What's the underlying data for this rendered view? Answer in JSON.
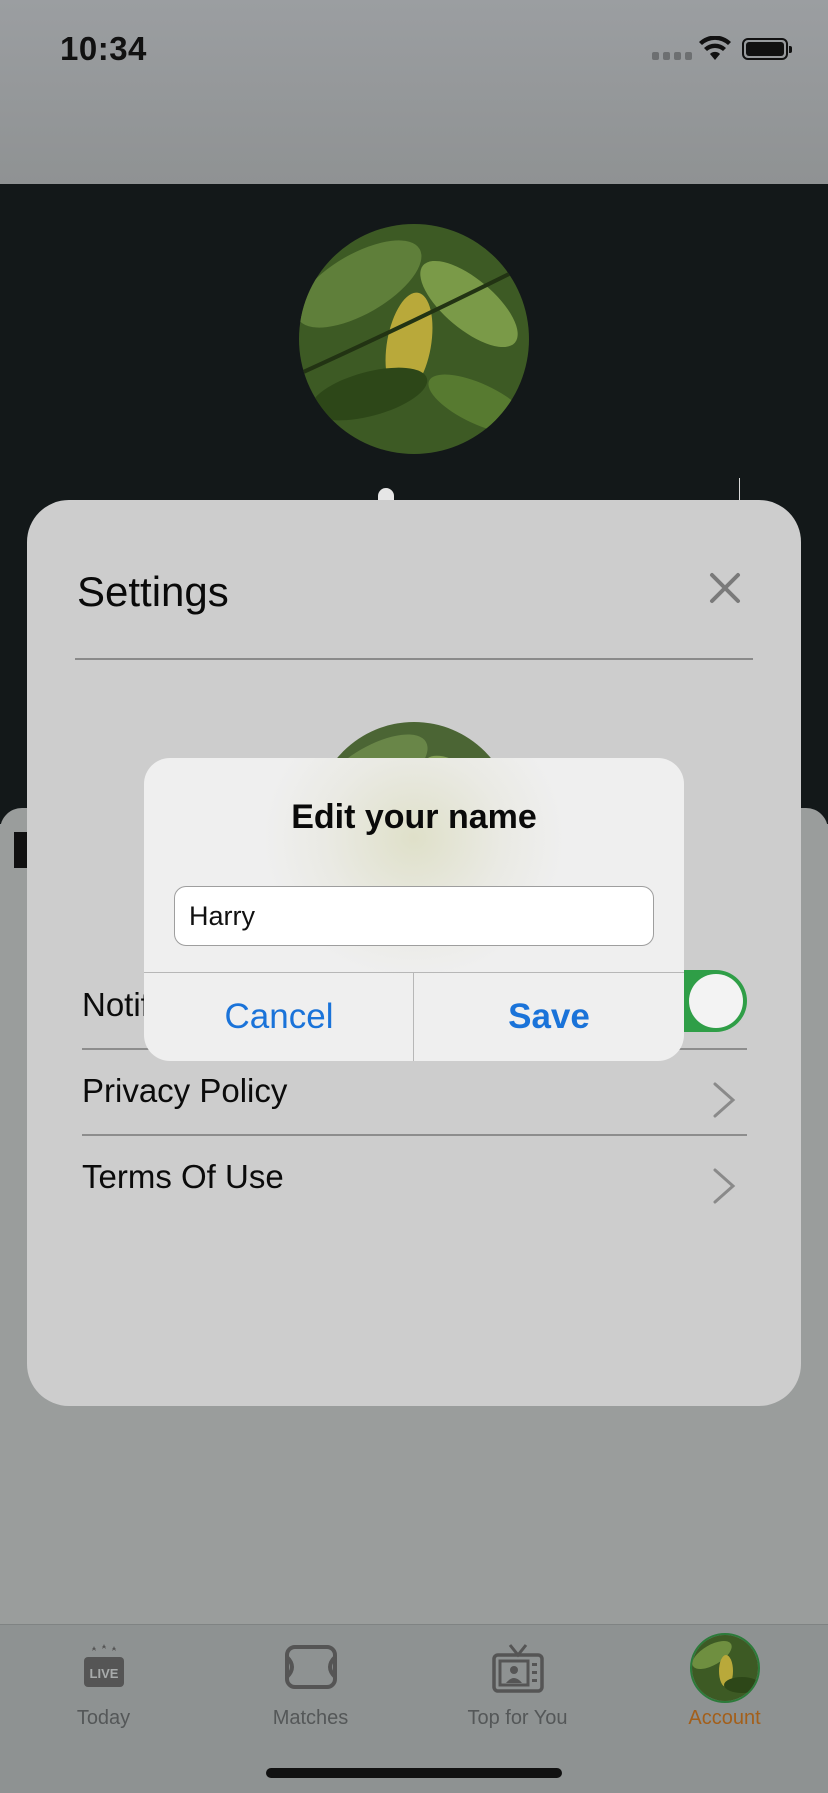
{
  "status_bar": {
    "time": "10:34"
  },
  "profile": {
    "avatar_icon": "leaf-photo"
  },
  "settings": {
    "title": "Settings",
    "close_icon": "close-icon",
    "rows": [
      {
        "label": "Notifications",
        "toggle_on": true
      },
      {
        "label": "Privacy Policy"
      },
      {
        "label": "Terms Of Use"
      }
    ]
  },
  "dialog": {
    "title": "Edit your name",
    "input_value": "Harry",
    "cancel_label": "Cancel",
    "save_label": "Save"
  },
  "tabbar": {
    "tabs": [
      {
        "label": "Today",
        "icon": "live-icon",
        "badge_text": "LIVE"
      },
      {
        "label": "Matches",
        "icon": "pitch-icon"
      },
      {
        "label": "Top for You",
        "icon": "tv-icon"
      },
      {
        "label": "Account",
        "icon": "avatar",
        "active": true
      }
    ]
  },
  "colors": {
    "accent_blue": "#1a73d9",
    "toggle_green": "#2f9e47",
    "active_tab": "#a35f1a"
  }
}
